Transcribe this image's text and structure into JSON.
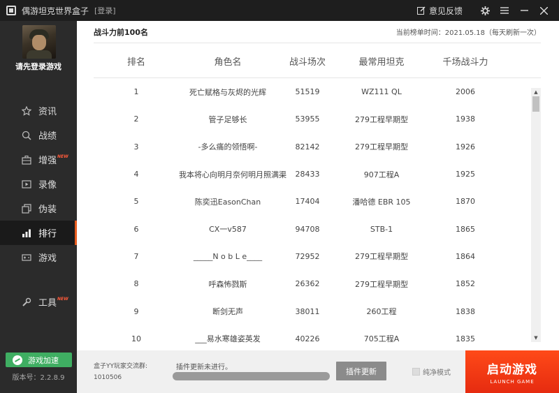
{
  "titlebar": {
    "app_title": "偶游坦克世界盒子",
    "login_label": "[登录]",
    "feedback_label": "意见反馈"
  },
  "sidebar": {
    "login_tip": "请先登录游戏",
    "items": [
      {
        "label": "资讯",
        "icon": "star-icon",
        "new": false
      },
      {
        "label": "战绩",
        "icon": "search-icon",
        "new": false
      },
      {
        "label": "增强",
        "icon": "toolbox-icon",
        "new": true
      },
      {
        "label": "录像",
        "icon": "play-icon",
        "new": false
      },
      {
        "label": "伪装",
        "icon": "layers-icon",
        "new": false
      },
      {
        "label": "排行",
        "icon": "bar-chart-icon",
        "new": false,
        "active": true
      },
      {
        "label": "游戏",
        "icon": "gamepad-icon",
        "new": false
      }
    ],
    "tools_label": "工具",
    "new_badge": "NEW",
    "speedup_label": "游戏加速",
    "version": "版本号：2.2.8.9"
  },
  "main": {
    "title": "战斗力前100名",
    "update_time": "当前榜单时间：2021.05.18（每天刷新一次）",
    "columns": [
      "排名",
      "角色名",
      "战斗场次",
      "最常用坦克",
      "千场战斗力"
    ],
    "rows": [
      {
        "rank": "1",
        "name": "死亡赋格与灰烬的光辉",
        "battles": "51519",
        "tank": "WZ111 QL",
        "power": "2006"
      },
      {
        "rank": "2",
        "name": "管子足够长",
        "battles": "53955",
        "tank": "279工程早期型",
        "power": "1938"
      },
      {
        "rank": "3",
        "name": "-多么痛的领悟啊-",
        "battles": "82142",
        "tank": "279工程早期型",
        "power": "1926"
      },
      {
        "rank": "4",
        "name": "我本将心向明月奈何明月照满渠",
        "battles": "28433",
        "tank": "907工程A",
        "power": "1925"
      },
      {
        "rank": "5",
        "name": "陈奕迅EasonChan",
        "battles": "17404",
        "tank": "潘哈德 EBR 105",
        "power": "1870"
      },
      {
        "rank": "6",
        "name": "CX一v587",
        "battles": "94708",
        "tank": "STB-1",
        "power": "1865"
      },
      {
        "rank": "7",
        "name": "_____N o b L e____",
        "battles": "72952",
        "tank": "279工程早期型",
        "power": "1864"
      },
      {
        "rank": "8",
        "name": "呼森怖戮斯",
        "battles": "26362",
        "tank": "279工程早期型",
        "power": "1852"
      },
      {
        "rank": "9",
        "name": "断剑无声",
        "battles": "38011",
        "tank": "260工程",
        "power": "1838"
      },
      {
        "rank": "10",
        "name": "___易水寒雄姿英发",
        "battles": "40226",
        "tank": "705工程A",
        "power": "1835"
      }
    ]
  },
  "bottom": {
    "qq_group_label": "盒子YY玩家交流群:",
    "qq_group_number": "1010506",
    "plugin_status": "插件更新未进行。",
    "plugin_progress": 0,
    "plugin_button": "插件更新",
    "pure_mode_label": "纯净模式",
    "launch_cn": "启动游戏",
    "launch_en": "LAUNCH GAME"
  },
  "colors": {
    "accent": "#e85c1e",
    "launch": "#f0341a",
    "speedup": "#3fae62"
  }
}
